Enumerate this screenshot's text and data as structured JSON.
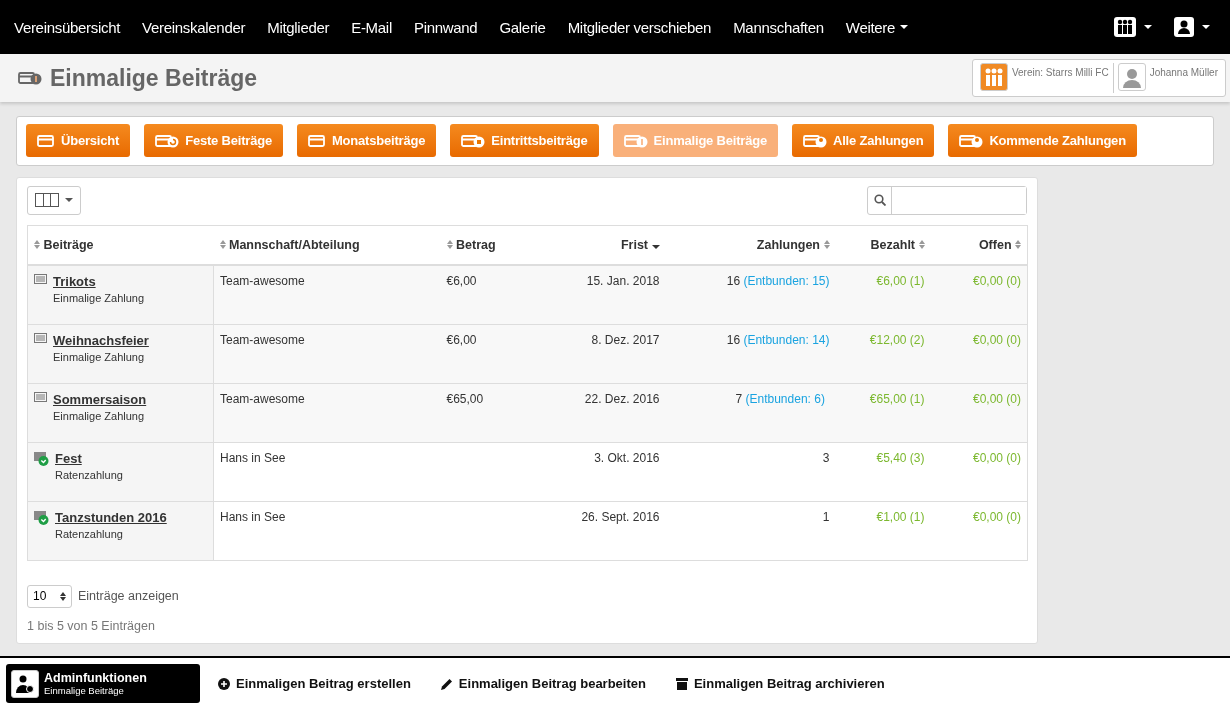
{
  "nav": {
    "items": [
      {
        "label": "Vereinsübersicht",
        "kind": "link"
      },
      {
        "label": "Vereinskalender",
        "kind": "link"
      },
      {
        "label": "Mitglieder",
        "kind": "link"
      },
      {
        "label": "E-Mail",
        "kind": "link"
      },
      {
        "label": "Pinnwand",
        "kind": "link"
      },
      {
        "label": "Galerie",
        "kind": "link"
      },
      {
        "label": "Mitglieder verschieben",
        "kind": "link"
      },
      {
        "label": "Mannschaften",
        "kind": "link"
      },
      {
        "label": "Weitere",
        "kind": "dropdown"
      }
    ]
  },
  "header": {
    "title": "Einmalige Beiträge",
    "club": "Verein: Starrs Milli FC",
    "user": "Johanna Müller"
  },
  "tabs": [
    {
      "label": "Übersicht",
      "selected": false
    },
    {
      "label": "Feste Beiträge",
      "selected": false
    },
    {
      "label": "Monatsbeiträge",
      "selected": false
    },
    {
      "label": "Eintrittsbeiträge",
      "selected": false
    },
    {
      "label": "Einmalige Beiträge",
      "selected": true
    },
    {
      "label": "Alle Zahlungen",
      "selected": false
    },
    {
      "label": "Kommende Zahlungen",
      "selected": false
    }
  ],
  "table": {
    "columns": [
      {
        "label": "Beiträge",
        "sorted": false
      },
      {
        "label": "Mannschaft/Abteilung",
        "sorted": false
      },
      {
        "label": "Betrag",
        "sorted": false
      },
      {
        "label": "Frist",
        "sorted": true
      },
      {
        "label": "Zahlungen",
        "sorted": false
      },
      {
        "label": "Bezahlt",
        "sorted": false
      },
      {
        "label": "Offen",
        "sorted": false
      }
    ],
    "rows": [
      {
        "name": "Trikots",
        "type": "Einmalige Zahlung",
        "kind": "single",
        "team": "Team-awesome",
        "amount": "€6,00",
        "deadline": "15. Jan. 2018",
        "payments": "16",
        "released": "(Entbunden: 15)",
        "paid": "€6,00 (1)",
        "open": "€0,00 (0)"
      },
      {
        "name": "Weihnachsfeier",
        "type": "Einmalige Zahlung",
        "kind": "single",
        "team": "Team-awesome",
        "amount": "€6,00",
        "deadline": "8. Dez. 2017",
        "payments": "16",
        "released": "(Entbunden: 14)",
        "paid": "€12,00 (2)",
        "open": "€0,00 (0)"
      },
      {
        "name": "Sommersaison",
        "type": "Einmalige Zahlung",
        "kind": "single",
        "team": "Team-awesome",
        "amount": "€65,00",
        "deadline": "22. Dez. 2016",
        "payments": "7",
        "released": "(Entbunden: 6)",
        "paid": "€65,00 (1)",
        "open": "€0,00 (0)"
      },
      {
        "name": "Fest",
        "type": "Ratenzahlung",
        "kind": "installment",
        "team": "Hans in See",
        "deadline": "3. Okt. 2016",
        "payments": "3",
        "paid": "€5,40 (3)",
        "open": "€0,00 (0)"
      },
      {
        "name": "Tanzstunden 2016",
        "type": "Ratenzahlung",
        "kind": "installment",
        "team": "Hans in See",
        "deadline": "26. Sept. 2016",
        "payments": "1",
        "paid": "€1,00 (1)",
        "open": "€0,00 (0)"
      }
    ]
  },
  "length": {
    "value": "10",
    "label": "Einträge anzeigen"
  },
  "info": "1 bis 5 von 5 Einträgen",
  "admin": {
    "title": "Adminfunktionen",
    "subtitle": "Einmalige Beiträge",
    "actions": [
      {
        "label": "Einmaligen Beitrag erstellen"
      },
      {
        "label": "Einmaligen Beitrag bearbeiten"
      },
      {
        "label": "Einmaligen Beitrag archivieren"
      }
    ]
  }
}
